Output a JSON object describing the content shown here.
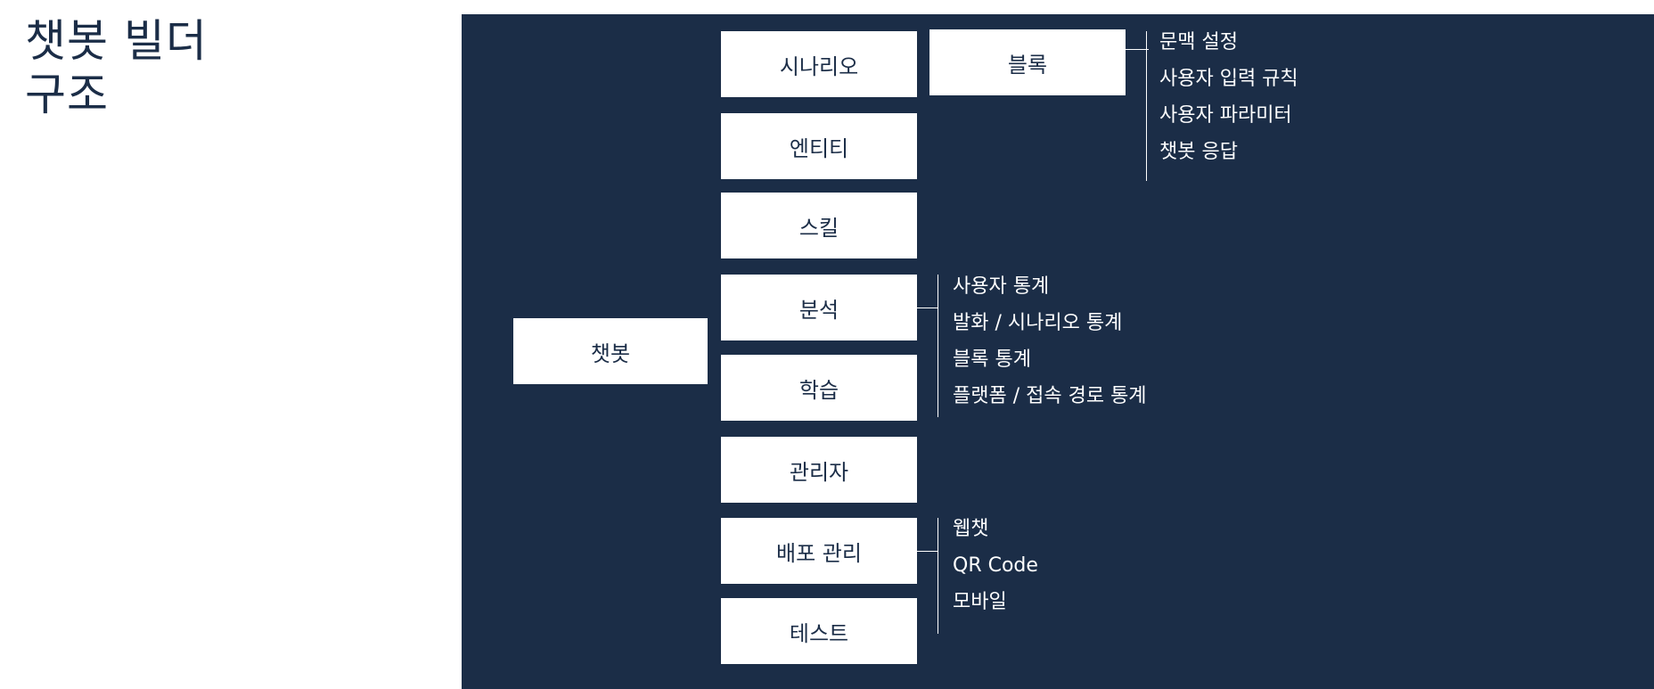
{
  "title": {
    "line1": "챗봇 빌더",
    "line2": "구조"
  },
  "diagram": {
    "root": "챗봇",
    "modules": [
      "시나리오",
      "엔티티",
      "스킬",
      "분석",
      "학습",
      "관리자",
      "배포 관리",
      "테스트"
    ],
    "scenario_block": "블록",
    "block_items": [
      "문맥 설정",
      "사용자 입력 규칙",
      "사용자 파라미터",
      "챗봇 응답"
    ],
    "analysis_items": [
      "사용자 통계",
      "발화 / 시나리오 통계",
      "블록 통계",
      "플랫폼 / 접속 경로 통계"
    ],
    "deploy_items": [
      "웹챗",
      "QR Code",
      "모바일"
    ]
  },
  "colors": {
    "panel": "#1b2d47",
    "box": "#ffffff",
    "text_dark": "#1b2d47",
    "text_light": "#ffffff"
  }
}
